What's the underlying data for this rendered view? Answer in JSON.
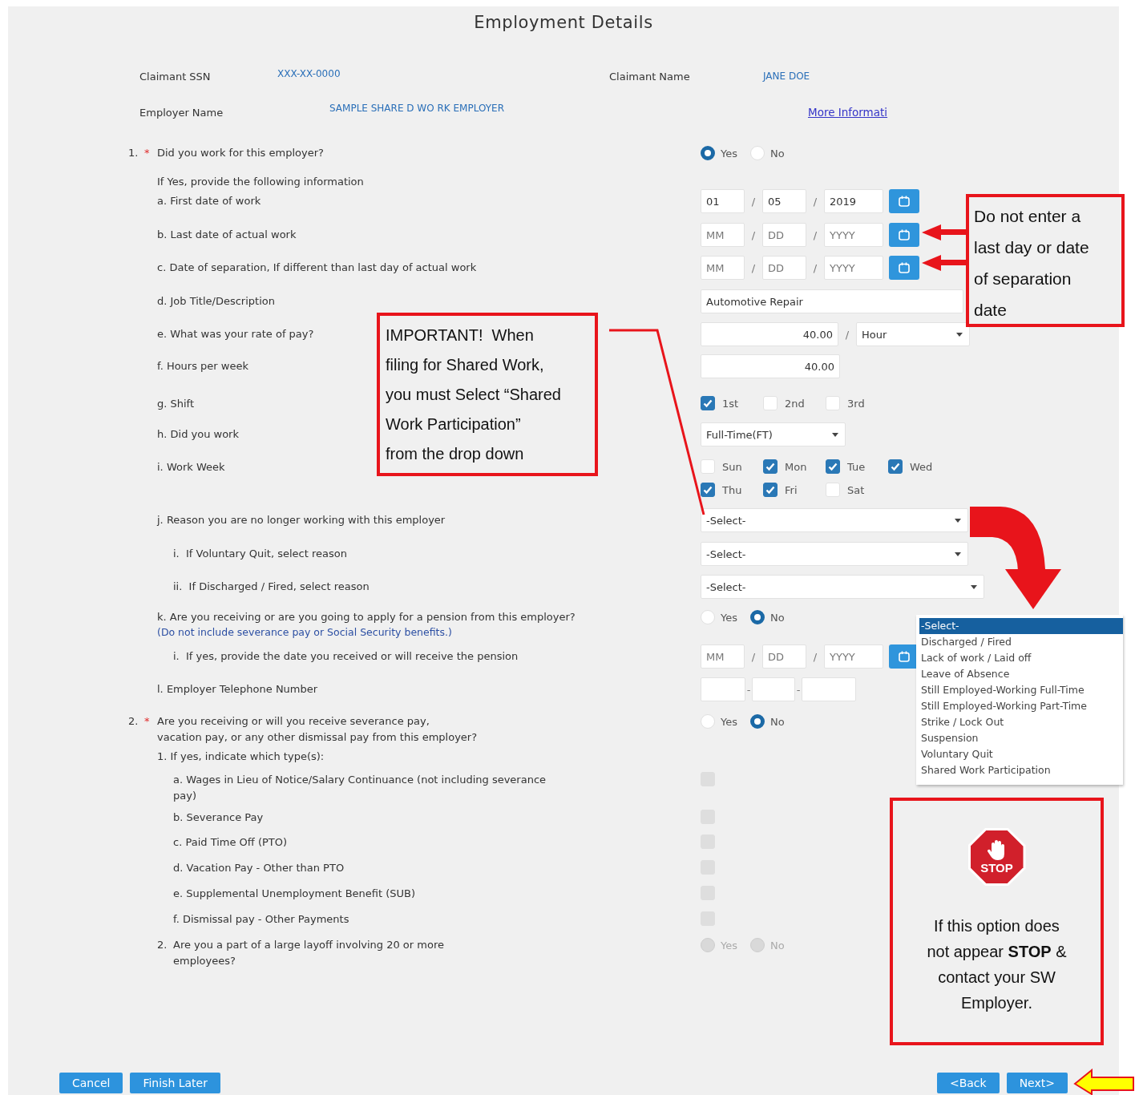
{
  "title": "Employment Details",
  "header": {
    "ssn_label": "Claimant SSN",
    "ssn": "XXX-XX-0000",
    "name_label": "Claimant Name",
    "name": "JANE DOE",
    "employer_label": "Employer Name",
    "employer": "SAMPLE SHARE D WO RK EMPLOYER",
    "link": "More Informati"
  },
  "questions": [
    {
      "number": "1.",
      "required_mark": "*",
      "text": "Did you work for this employer?",
      "control": {
        "kind": "radio",
        "disabled": false,
        "options": [
          {
            "label": "Yes",
            "selected": true
          },
          {
            "label": "No",
            "selected": false
          }
        ]
      },
      "children": [
        {
          "text": "If Yes, provide the following information"
        },
        {
          "text": "a. First date of work",
          "control": {
            "kind": "date",
            "separator": "/",
            "fields": [
              {
                "value": "01"
              },
              {
                "value": "05"
              },
              {
                "value": "2019"
              }
            ]
          }
        },
        {
          "text": "b. Last date of actual work",
          "control": {
            "kind": "date",
            "separator": "/",
            "fields": [
              {
                "placeholder": "MM"
              },
              {
                "placeholder": "DD"
              },
              {
                "placeholder": "YYYY"
              }
            ]
          }
        },
        {
          "text": "c. Date of separation, If different than last day of actual work",
          "control": {
            "kind": "date",
            "separator": "/",
            "fields": [
              {
                "placeholder": "MM"
              },
              {
                "placeholder": "DD"
              },
              {
                "placeholder": "YYYY"
              }
            ]
          }
        },
        {
          "text": "d. Job Title/Description",
          "control": {
            "kind": "text",
            "value": "Automotive Repair"
          }
        },
        {
          "text": "e. What was your rate of pay?",
          "control": {
            "kind": "rate",
            "value": "40.00",
            "separator": "/",
            "unit": "Hour"
          }
        },
        {
          "text": "f. Hours per week",
          "control": {
            "kind": "number",
            "value": "40.00"
          }
        },
        {
          "text": "g. Shift",
          "control": {
            "kind": "checks",
            "options": [
              {
                "label": "1st",
                "checked": true
              },
              {
                "label": "2nd",
                "checked": false
              },
              {
                "label": "3rd",
                "checked": false
              }
            ]
          }
        },
        {
          "text": "h. Did you work",
          "control": {
            "kind": "short_select",
            "value": "Full-Time(FT)"
          }
        },
        {
          "text": "i. Work Week",
          "control": {
            "kind": "checks",
            "options": [
              {
                "label": "Sun",
                "checked": false
              },
              {
                "label": "Mon",
                "checked": true
              },
              {
                "label": "Tue",
                "checked": true
              },
              {
                "label": "Wed",
                "checked": true
              },
              {
                "label": "Thu",
                "checked": true
              },
              {
                "label": "Fri",
                "checked": true
              },
              {
                "label": "Sat",
                "checked": false
              }
            ]
          }
        },
        {
          "text": "j. Reason you are no longer working with this employer",
          "control": {
            "kind": "select",
            "value": "-Select-"
          },
          "children": [
            {
              "text": "i.  If Voluntary Quit, select reason",
              "control": {
                "kind": "select",
                "value": "-Select-"
              }
            },
            {
              "text": "ii.  If Discharged / Fired, select reason",
              "control": {
                "kind": "wide_select",
                "value": "-Select-"
              }
            }
          ]
        },
        {
          "text": "k. Are you receiving or are you going to apply for a pension from this employer?",
          "note": "(Do not include severance pay or Social Security benefits.)",
          "control": {
            "kind": "radio",
            "disabled": false,
            "options": [
              {
                "label": "Yes",
                "selected": false
              },
              {
                "label": "No",
                "selected": true
              }
            ]
          },
          "children": [
            {
              "text": "i.  If yes, provide the date you received or will receive the pension",
              "control": {
                "kind": "date",
                "separator": "/",
                "fields": [
                  {
                    "placeholder": "MM"
                  },
                  {
                    "placeholder": "DD"
                  },
                  {
                    "placeholder": "YYYY"
                  }
                ]
              }
            }
          ]
        },
        {
          "text": "l. Employer Telephone Number",
          "control": {
            "kind": "phone",
            "separator": "-"
          }
        }
      ]
    },
    {
      "number": "2.",
      "required_mark": "*",
      "text": "Are you receiving or will you receive severance pay,\nvacation pay, or any other dismissal pay from this employer?",
      "control": {
        "kind": "radio",
        "disabled": false,
        "options": [
          {
            "label": "Yes",
            "selected": false
          },
          {
            "label": "No",
            "selected": true
          }
        ]
      },
      "children": [
        {
          "text": "1. If yes, indicate which type(s):",
          "children": [
            {
              "text": "a. Wages in Lieu of Notice/Salary Continuance (not including severance pay)",
              "control": {
                "kind": "checkbox",
                "checked": false,
                "disabled": true
              }
            },
            {
              "text": "b. Severance Pay",
              "control": {
                "kind": "checkbox",
                "checked": false,
                "disabled": true
              }
            },
            {
              "text": "c. Paid Time Off (PTO)",
              "control": {
                "kind": "checkbox",
                "checked": false,
                "disabled": true
              }
            },
            {
              "text": "d. Vacation Pay - Other than PTO",
              "control": {
                "kind": "checkbox",
                "checked": false,
                "disabled": true
              }
            },
            {
              "text": "e. Supplemental Unemployment Benefit (SUB)",
              "control": {
                "kind": "checkbox",
                "checked": false,
                "disabled": true
              }
            },
            {
              "text": "f. Dismissal pay - Other Payments",
              "control": {
                "kind": "checkbox",
                "checked": false,
                "disabled": true
              }
            }
          ]
        },
        {
          "number": "2.",
          "text": "Are you a part of a large layoff involving 20 or more employees?",
          "control": {
            "kind": "radio",
            "disabled": true,
            "options": [
              {
                "label": "Yes",
                "selected": false
              },
              {
                "label": "No",
                "selected": false
              }
            ]
          }
        }
      ]
    }
  ],
  "dropdown": {
    "options": [
      {
        "label": "-Select-",
        "selected": true
      },
      {
        "label": "Discharged / Fired",
        "selected": false
      },
      {
        "label": "Lack of work / Laid off",
        "selected": false
      },
      {
        "label": "Leave of Absence",
        "selected": false
      },
      {
        "label": "Still Employed-Working Full-Time",
        "selected": false
      },
      {
        "label": "Still Employed-Working Part-Time",
        "selected": false
      },
      {
        "label": "Strike / Lock Out",
        "selected": false
      },
      {
        "label": "Suspension",
        "selected": false
      },
      {
        "label": "Voluntary Quit",
        "selected": false
      },
      {
        "label": "Shared Work Participation",
        "selected": false
      }
    ]
  },
  "annotations": [
    {
      "kind": "callout",
      "text": "IMPORTANT!  When\nfiling for Shared Work,\nyou must Select “Shared\nWork Participation”\nfrom the drop down"
    },
    {
      "kind": "side_note",
      "text": "Do not enter a\nlast day or date\nof separation\ndate"
    },
    {
      "kind": "stop",
      "sign": "STOP",
      "text": "If this option does\nnot appear **STOP** &\ncontact your SW\nEmployer."
    }
  ],
  "buttons_left": [
    "Cancel",
    "Finish Later"
  ],
  "buttons_right": [
    "<Back",
    "Next>"
  ]
}
